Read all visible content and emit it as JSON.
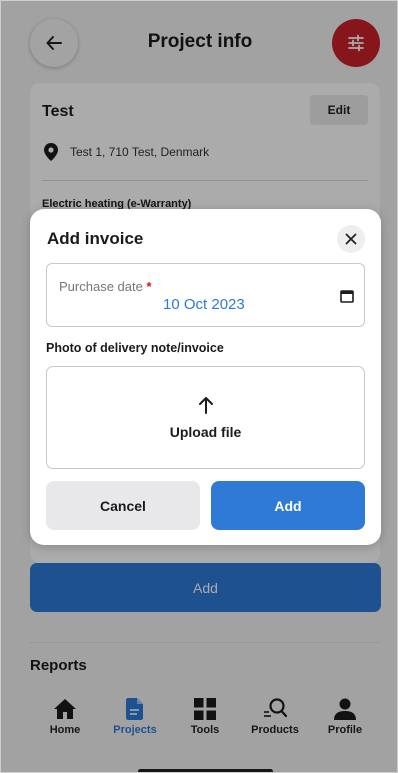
{
  "header": {
    "title": "Project info",
    "back_icon": "arrow-left-icon",
    "filter_icon": "sliders-icon"
  },
  "project": {
    "name": "Test",
    "edit_label": "Edit",
    "address": "Test 1, 710 Test, Denmark",
    "warranty_label": "Electric heating (e-Warranty)",
    "add_label": "Add"
  },
  "reports": {
    "title": "Reports"
  },
  "nav": {
    "items": [
      {
        "label": "Home",
        "icon": "home-icon"
      },
      {
        "label": "Projects",
        "icon": "document-icon"
      },
      {
        "label": "Tools",
        "icon": "grid-icon"
      },
      {
        "label": "Products",
        "icon": "search-icon"
      },
      {
        "label": "Profile",
        "icon": "person-icon"
      }
    ],
    "active": "Projects"
  },
  "modal": {
    "title": "Add invoice",
    "close_icon": "close-icon",
    "purchase_date_label": "Purchase date",
    "required_mark": "*",
    "purchase_date_value": "10 Oct 2023",
    "photo_label": "Photo of delivery note/invoice",
    "upload_label": "Upload file",
    "cancel_label": "Cancel",
    "add_label": "Add"
  },
  "colors": {
    "accent": "#2e7ad6",
    "brand_red": "#c8222b",
    "required": "#dd1111"
  }
}
